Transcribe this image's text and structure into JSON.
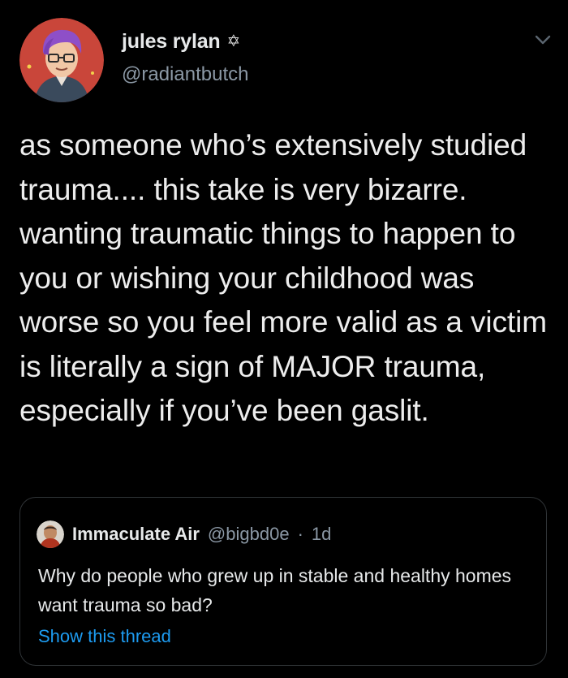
{
  "tweet": {
    "author": {
      "display_name": "jules rylan",
      "badge_icon": "✡",
      "handle": "@radiantbutch",
      "avatar_icon": "avatar-illustration"
    },
    "text": "as someone who’s extensively studied trauma.... this take is very bizarre. wanting traumatic things to happen to you or wishing your childhood was worse so you feel more valid as a victim is literally a sign of MAJOR trauma, especially if you’ve been gaslit.",
    "menu_icon": "chevron-down-icon"
  },
  "quote": {
    "display_name": "Immaculate Air",
    "handle": "@bigbd0e",
    "separator": "·",
    "time": "1d",
    "text": "Why do people who grew up in stable and healthy homes want trauma so bad?",
    "show_thread": "Show this thread"
  },
  "colors": {
    "background": "#000000",
    "text": "#e7e9ea",
    "secondary": "#8b98a5",
    "link": "#1d9bf0",
    "border": "#2f3336"
  }
}
